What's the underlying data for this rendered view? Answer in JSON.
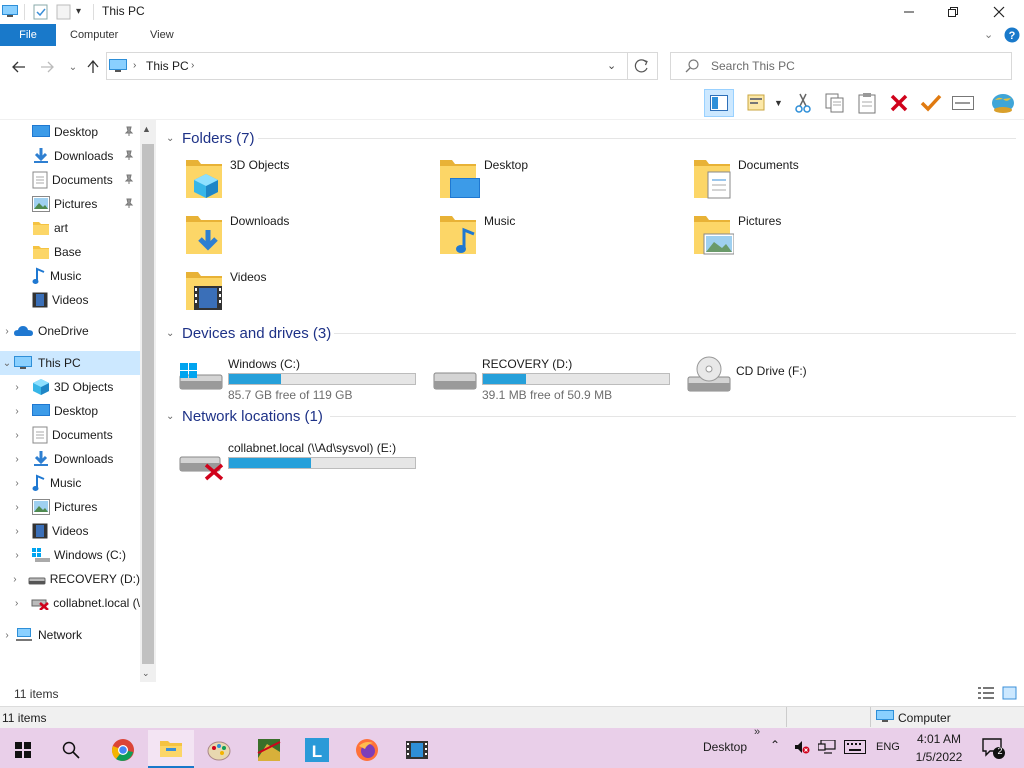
{
  "window": {
    "title": "This PC"
  },
  "ribbon": {
    "file": "File",
    "computer": "Computer",
    "view": "View"
  },
  "address": {
    "crumb": "This PC",
    "search_placeholder": "Search This PC"
  },
  "nav": {
    "quick": [
      {
        "label": "Desktop",
        "icon": "desktop-icon"
      },
      {
        "label": "Downloads",
        "icon": "downloads-icon"
      },
      {
        "label": "Documents",
        "icon": "documents-icon"
      },
      {
        "label": "Pictures",
        "icon": "pictures-icon"
      },
      {
        "label": "art",
        "icon": "folder-icon"
      },
      {
        "label": "Base",
        "icon": "folder-icon"
      },
      {
        "label": "Music",
        "icon": "music-icon"
      },
      {
        "label": "Videos",
        "icon": "videos-icon"
      }
    ],
    "onedrive": "OneDrive",
    "thispc": "This PC",
    "pc_items": [
      {
        "label": "3D Objects"
      },
      {
        "label": "Desktop"
      },
      {
        "label": "Documents"
      },
      {
        "label": "Downloads"
      },
      {
        "label": "Music"
      },
      {
        "label": "Pictures"
      },
      {
        "label": "Videos"
      },
      {
        "label": "Windows (C:)"
      },
      {
        "label": "RECOVERY (D:)"
      },
      {
        "label": "collabnet.local (\\"
      }
    ],
    "network": "Network"
  },
  "groups": {
    "folders": "Folders (7)",
    "devices": "Devices and drives (3)",
    "network": "Network locations (1)"
  },
  "folders": [
    "3D Objects",
    "Desktop",
    "Documents",
    "Downloads",
    "Music",
    "Pictures",
    "Videos"
  ],
  "drives": [
    {
      "name": "Windows (C:)",
      "free": "85.7 GB free of 119 GB",
      "used_fraction": 0.28
    },
    {
      "name": "RECOVERY (D:)",
      "free": "39.1 MB free of 50.9 MB",
      "used_fraction": 0.23
    },
    {
      "name": "CD Drive (F:)"
    }
  ],
  "netloc": {
    "name": "collabnet.local (\\\\Ad\\sysvol) (E:)",
    "used_fraction": 0.44
  },
  "status": {
    "items": "11 items",
    "items2": "11 items",
    "computer": "Computer"
  },
  "taskbar": {
    "desktop": "Desktop",
    "lang": "ENG",
    "time": "4:01 AM",
    "date": "1/5/2022",
    "notif_count": "2"
  },
  "colors": {
    "accent": "#1979ca",
    "selection": "#cce8ff",
    "progress": "#26a0da",
    "group": "#1e3287",
    "taskbar": "#e9cfe9"
  }
}
